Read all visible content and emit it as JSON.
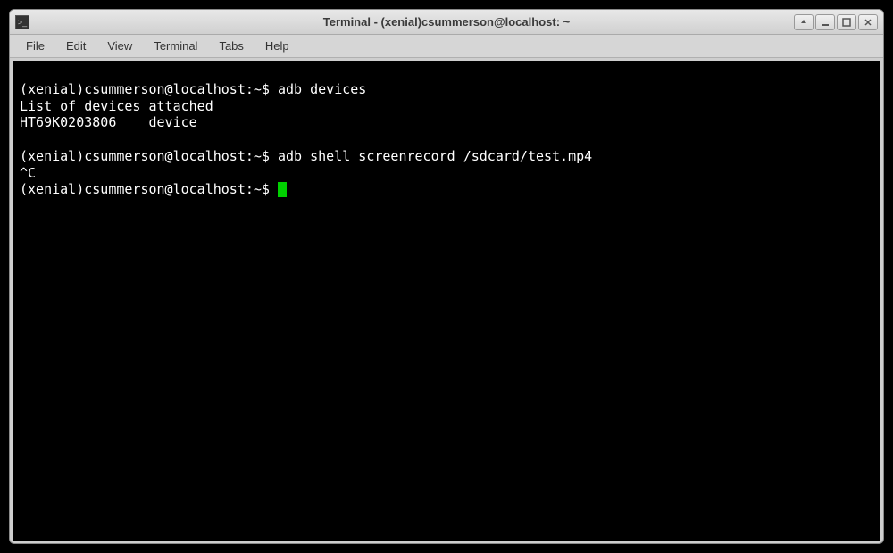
{
  "window": {
    "title": "Terminal - (xenial)csummerson@localhost: ~"
  },
  "menu": {
    "file": "File",
    "edit": "Edit",
    "view": "View",
    "terminal": "Terminal",
    "tabs": "Tabs",
    "help": "Help"
  },
  "prompt": "(xenial)csummerson@localhost:~$ ",
  "terminal": {
    "lines": [
      "(xenial)csummerson@localhost:~$ adb devices",
      "List of devices attached",
      "HT69K0203806    device",
      "",
      "(xenial)csummerson@localhost:~$ adb shell screenrecord /sdcard/test.mp4",
      "^C",
      "(xenial)csummerson@localhost:~$ "
    ]
  },
  "commands": {
    "cmd1": "adb devices",
    "out1a": "List of devices attached",
    "out1b": "HT69K0203806    device",
    "cmd2": "adb shell screenrecord /sdcard/test.mp4",
    "interrupt": "^C"
  }
}
